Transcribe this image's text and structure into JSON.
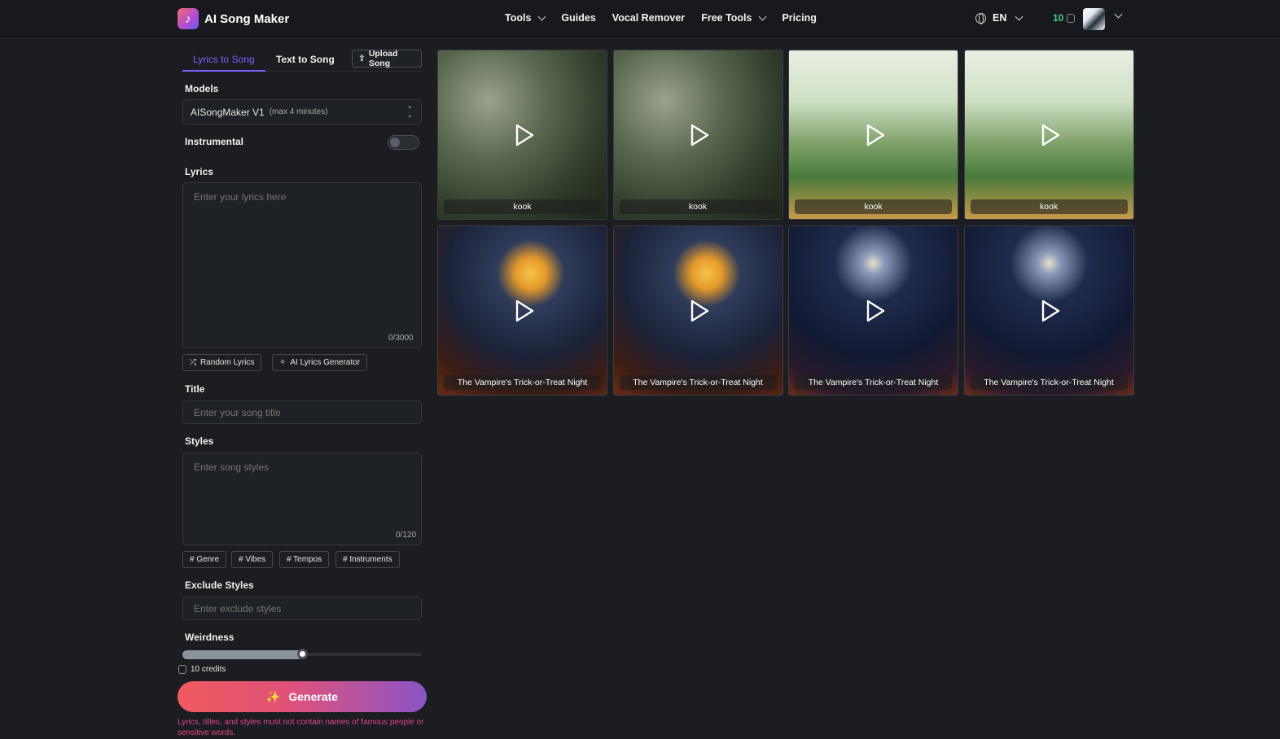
{
  "header": {
    "brand": "AI Song Maker",
    "nav": [
      {
        "label": "Tools",
        "dropdown": true
      },
      {
        "label": "Guides",
        "dropdown": false
      },
      {
        "label": "Vocal Remover",
        "dropdown": false
      },
      {
        "label": "Free Tools",
        "dropdown": true
      },
      {
        "label": "Pricing",
        "dropdown": false
      }
    ],
    "language": "EN",
    "credits": "10"
  },
  "panel": {
    "tabs": {
      "active": "Lyrics to Song",
      "other": "Text to Song",
      "upload": "Upload Song"
    },
    "models_label": "Models",
    "model_value": "AISongMaker V1",
    "model_hint": "(max 4 minutes)",
    "instrumental_label": "Instrumental",
    "instrumental_on": false,
    "lyrics_label": "Lyrics",
    "lyrics_placeholder": "Enter your lyrics here",
    "lyrics_counter": "0/3000",
    "random_lyrics": "Random Lyrics",
    "ai_lyrics": "AI Lyrics Generator",
    "title_label": "Title",
    "title_placeholder": "Enter your song title",
    "styles_label": "Styles",
    "styles_placeholder": "Enter song styles",
    "styles_counter": "0/120",
    "style_tags": [
      "# Genre",
      "# Vibes",
      "# Tempos",
      "# Instruments"
    ],
    "exclude_label": "Exclude Styles",
    "exclude_placeholder": "Enter exclude styles",
    "weirdness_label": "Weirdness",
    "weirdness_value": 0.5,
    "credits_text": "10 credits",
    "generate": "Generate",
    "warning": "Lyrics, titles, and styles must not contain names of famous people or sensitive words."
  },
  "songs": [
    {
      "title": "kook",
      "art": "bird"
    },
    {
      "title": "kook",
      "art": "bird"
    },
    {
      "title": "kook",
      "art": "tree"
    },
    {
      "title": "kook",
      "art": "tree"
    },
    {
      "title": "The Vampire's Trick-or-Treat Night",
      "art": "moon"
    },
    {
      "title": "The Vampire's Trick-or-Treat Night",
      "art": "moon"
    },
    {
      "title": "The Vampire's Trick-or-Treat Night",
      "art": "street"
    },
    {
      "title": "The Vampire's Trick-or-Treat Night",
      "art": "street"
    }
  ],
  "colors": {
    "accent": "#7b61ff",
    "credits": "#3cd28a",
    "warning": "#e0468b"
  }
}
